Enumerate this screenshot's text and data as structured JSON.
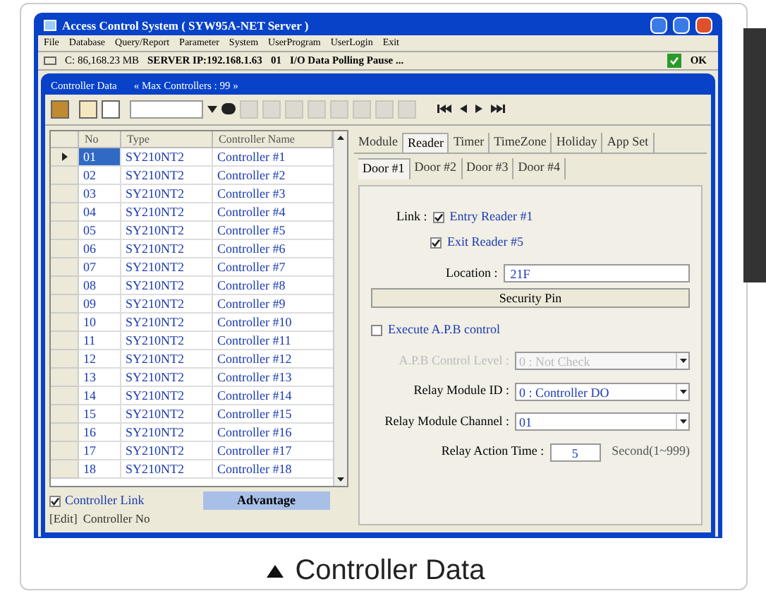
{
  "window": {
    "title": "Access Control System ( SYW95A-NET Server )"
  },
  "menu": [
    "File",
    "Database",
    "Query/Report",
    "Parameter",
    "System",
    "UserProgram",
    "UserLogin",
    "Exit"
  ],
  "status": {
    "disk": "C: 86,168.23 MB",
    "server": "SERVER IP:192.168.1.63",
    "port": "01",
    "message": "I/O Data Polling Pause ...",
    "ok_label": "OK",
    "ok": true
  },
  "child_window": {
    "title": "Controller Data",
    "subtitle": "« Max Controllers : 99 »"
  },
  "grid": {
    "columns": [
      "No",
      "Type",
      "Controller Name"
    ],
    "rows": [
      {
        "no": "01",
        "type": "SY210NT2",
        "name": "Controller #1",
        "selected": true
      },
      {
        "no": "02",
        "type": "SY210NT2",
        "name": "Controller #2",
        "selected": false
      },
      {
        "no": "03",
        "type": "SY210NT2",
        "name": "Controller #3",
        "selected": false
      },
      {
        "no": "04",
        "type": "SY210NT2",
        "name": "Controller #4",
        "selected": false
      },
      {
        "no": "05",
        "type": "SY210NT2",
        "name": "Controller #5",
        "selected": false
      },
      {
        "no": "06",
        "type": "SY210NT2",
        "name": "Controller #6",
        "selected": false
      },
      {
        "no": "07",
        "type": "SY210NT2",
        "name": "Controller #7",
        "selected": false
      },
      {
        "no": "08",
        "type": "SY210NT2",
        "name": "Controller #8",
        "selected": false
      },
      {
        "no": "09",
        "type": "SY210NT2",
        "name": "Controller #9",
        "selected": false
      },
      {
        "no": "10",
        "type": "SY210NT2",
        "name": "Controller #10",
        "selected": false
      },
      {
        "no": "11",
        "type": "SY210NT2",
        "name": "Controller #11",
        "selected": false
      },
      {
        "no": "12",
        "type": "SY210NT2",
        "name": "Controller #12",
        "selected": false
      },
      {
        "no": "13",
        "type": "SY210NT2",
        "name": "Controller #13",
        "selected": false
      },
      {
        "no": "14",
        "type": "SY210NT2",
        "name": "Controller #14",
        "selected": false
      },
      {
        "no": "15",
        "type": "SY210NT2",
        "name": "Controller #15",
        "selected": false
      },
      {
        "no": "16",
        "type": "SY210NT2",
        "name": "Controller #16",
        "selected": false
      },
      {
        "no": "17",
        "type": "SY210NT2",
        "name": "Controller #17",
        "selected": false
      },
      {
        "no": "18",
        "type": "SY210NT2",
        "name": "Controller #18",
        "selected": false
      }
    ]
  },
  "controller_link": {
    "label": "Controller Link",
    "checked": true
  },
  "advantage_button": "Advantage",
  "edit_hint": {
    "mode": "[Edit]",
    "field": "Controller No"
  },
  "tabs": [
    {
      "label": "Module",
      "selected": false
    },
    {
      "label": "Reader",
      "selected": true
    },
    {
      "label": "Timer",
      "selected": false
    },
    {
      "label": "TimeZone",
      "selected": false
    },
    {
      "label": "Holiday",
      "selected": false
    },
    {
      "label": "App Set",
      "selected": false
    }
  ],
  "door_tabs": [
    {
      "label": "Door #1",
      "selected": true
    },
    {
      "label": "Door #2",
      "selected": false
    },
    {
      "label": "Door #3",
      "selected": false
    },
    {
      "label": "Door #4",
      "selected": false
    }
  ],
  "reader": {
    "link_label": "Link :",
    "readers": [
      {
        "label": "Entry Reader #1",
        "checked": true
      },
      {
        "label": "Exit Reader #5",
        "checked": true
      }
    ],
    "location_label": "Location :",
    "location": "21F",
    "security_button": "Security Pin",
    "apb": {
      "label": "Execute A.P.B control",
      "checked": false
    },
    "selects": [
      {
        "label": "A.P.B Control Level :",
        "value": "0 : Not Check",
        "disabled": true
      },
      {
        "label": "Relay Module ID :",
        "value": "0 : Controller DO",
        "disabled": false
      },
      {
        "label": "Relay Module Channel :",
        "value": "01",
        "disabled": false
      }
    ],
    "relay_time": {
      "label": "Relay Action Time :",
      "value": "5",
      "unit": "Second(1~999)"
    }
  },
  "caption": "Controller Data"
}
